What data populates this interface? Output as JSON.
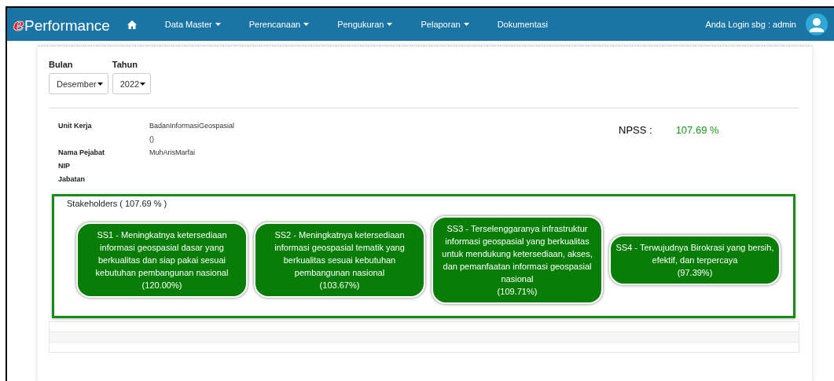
{
  "navbar": {
    "brand_mark": "e",
    "brand": "Performance",
    "menu": [
      {
        "label": "Data Master",
        "dropdown": true
      },
      {
        "label": "Perencanaan",
        "dropdown": true
      },
      {
        "label": "Pengukuran",
        "dropdown": true
      },
      {
        "label": "Pelaporan",
        "dropdown": true
      },
      {
        "label": "Dokumentasi",
        "dropdown": false
      }
    ],
    "login_text": "Anda Login sbg : admin"
  },
  "filters": [
    {
      "label": "Bulan",
      "value": "Desember"
    },
    {
      "label": "Tahun",
      "value": "2022"
    }
  ],
  "info": [
    {
      "label": "Unit Kerja",
      "value": "BadanInformasiGeospasial",
      "note": "()"
    },
    {
      "label": "Nama Pejabat",
      "value": "MuhArisMarfai"
    },
    {
      "label": "NIP"
    },
    {
      "label": "Jabatan"
    }
  ],
  "npss": {
    "label": "NPSS :",
    "value": "107.69 %"
  },
  "stakeholders": {
    "title": "Stakeholders ( 107.69 % )",
    "goals": [
      {
        "text": "SS1 - Meningkatnya ketersediaan informasi geospasial dasar yang berkualitas dan siap pakai sesuai kebutuhan pembangunan nasional",
        "score": "(120.00%)"
      },
      {
        "text": "SS2 - Meningkatnya ketersediaan informasi geospasial tematik yang berkualitas sesuai kebutuhan pembangunan nasional",
        "score": "(103.67%)"
      },
      {
        "text": "SS3 - Terselenggaranya infrastruktur informasi geospasial yang berkualitas untuk mendukung ketersediaan, akses, dan pemanfaatan informasi geospasial nasional",
        "score": "(109.71%)"
      },
      {
        "text": "SS4 - Terwujudnya Birokrasi yang bersih, efektif, dan terpercaya",
        "score": "(97.39%)"
      }
    ]
  }
}
